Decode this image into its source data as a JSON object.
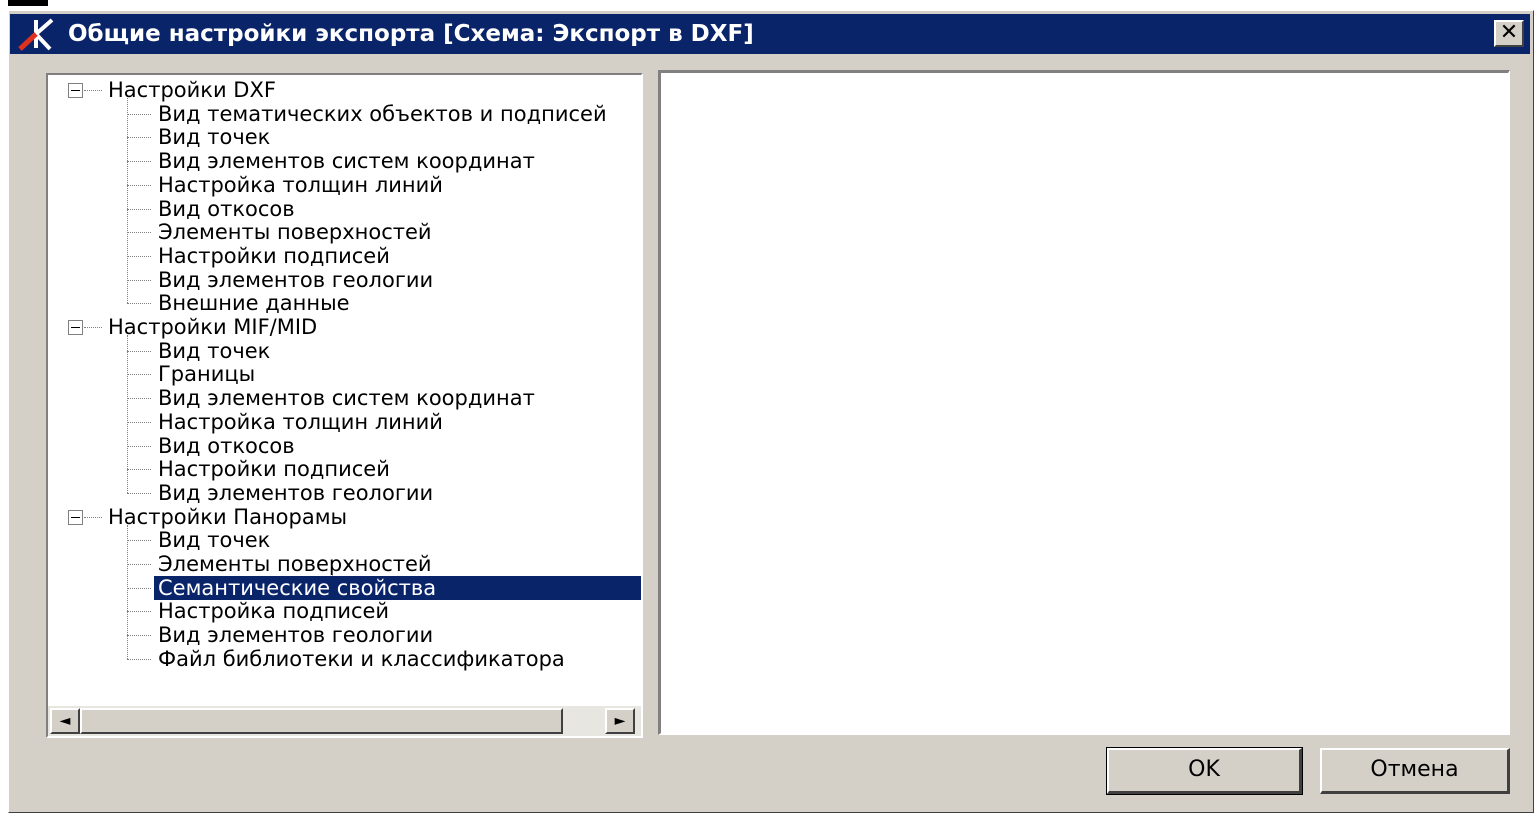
{
  "window": {
    "title": "Общие настройки экспорта [Схема: Экспорт в DXF]",
    "close_label": "✕",
    "accent_color": "#0a246a"
  },
  "tree": {
    "groups": [
      {
        "label": "Настройки DXF",
        "expanded": true,
        "items": [
          "Вид тематических объектов и подписей",
          "Вид точек",
          "Вид элементов систем координат",
          "Настройка толщин линий",
          "Вид откосов",
          "Элементы поверхностей",
          "Настройки подписей",
          "Вид элементов геологии",
          "Внешние данные"
        ]
      },
      {
        "label": "Настройки MIF/MID",
        "expanded": true,
        "items": [
          "Вид точек",
          "Границы",
          "Вид элементов систем координат",
          "Настройка толщин линий",
          "Вид откосов",
          "Настройки подписей",
          "Вид элементов геологии"
        ]
      },
      {
        "label": "Настройки Панорамы",
        "expanded": true,
        "items": [
          "Вид точек",
          "Элементы поверхностей",
          "Семантические свойства",
          "Настройка подписей",
          "Вид элементов геологии",
          "Файл библиотеки и классификатора"
        ]
      }
    ],
    "selected": "Семантические свойства",
    "scroll_left_icon": "◄",
    "scroll_right_icon": "►"
  },
  "buttons": {
    "ok_label": "OK",
    "cancel_label": "Отмена"
  }
}
